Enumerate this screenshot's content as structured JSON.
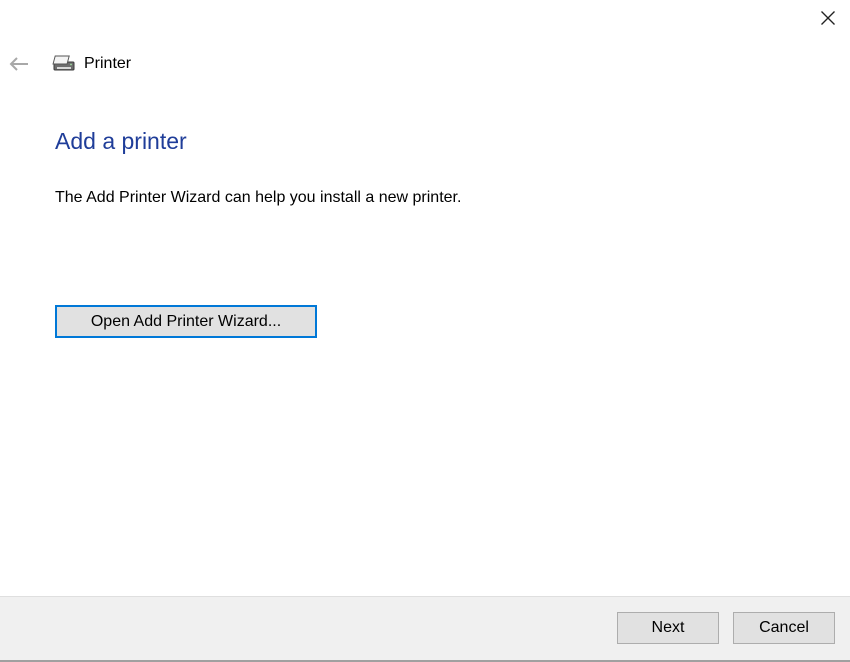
{
  "window": {
    "close_icon": "close-icon"
  },
  "header": {
    "back_icon": "back-arrow-icon",
    "printer_icon": "printer-icon",
    "title": "Printer"
  },
  "main": {
    "title": "Add a printer",
    "description": "The Add Printer Wizard can help you install a new printer.",
    "wizard_button_label": "Open Add Printer Wizard..."
  },
  "footer": {
    "next_label": "Next",
    "cancel_label": "Cancel"
  },
  "colors": {
    "title_blue": "#1f3d99",
    "focus_border": "#0078d7",
    "footer_bg": "#f0f0f0",
    "button_bg": "#e1e1e1"
  }
}
